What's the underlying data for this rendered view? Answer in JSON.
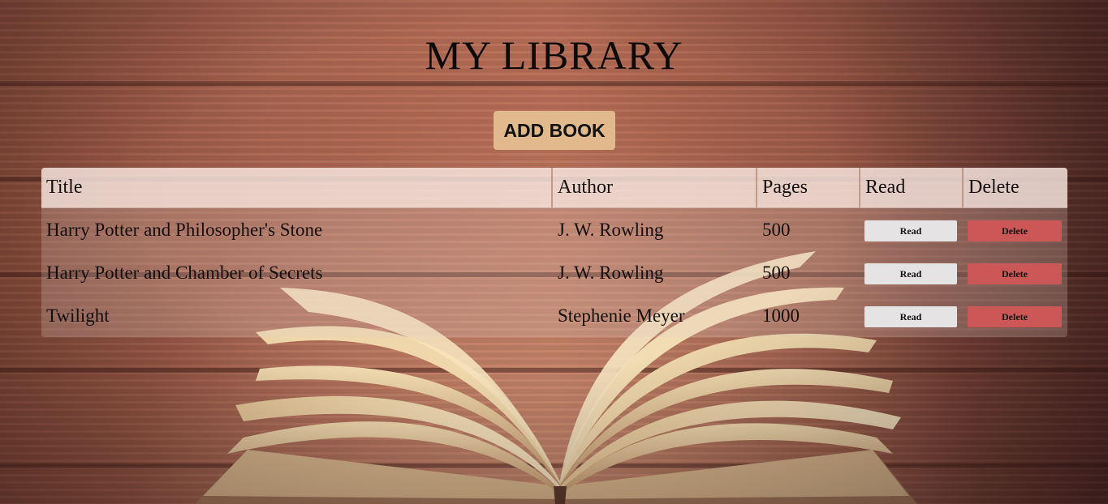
{
  "header": {
    "title": "MY LIBRARY",
    "add_button_label": "ADD BOOK"
  },
  "table": {
    "columns": [
      "Title",
      "Author",
      "Pages",
      "Read",
      "Delete"
    ],
    "rows": [
      {
        "title": "Harry Potter and Philosopher's Stone",
        "author": "J. W. Rowling",
        "pages": "500",
        "read_label": "Read",
        "delete_label": "Delete"
      },
      {
        "title": "Harry Potter and Chamber of Secrets",
        "author": "J. W. Rowling",
        "pages": "500",
        "read_label": "Read",
        "delete_label": "Delete"
      },
      {
        "title": "Twilight",
        "author": "Stephenie Meyer",
        "pages": "1000",
        "read_label": "Read",
        "delete_label": "Delete"
      }
    ]
  },
  "colors": {
    "add_button": "#e2b98c",
    "read_button": "#e6e3e4",
    "delete_button": "#cc5757",
    "header_row": "#f8e8e2"
  }
}
